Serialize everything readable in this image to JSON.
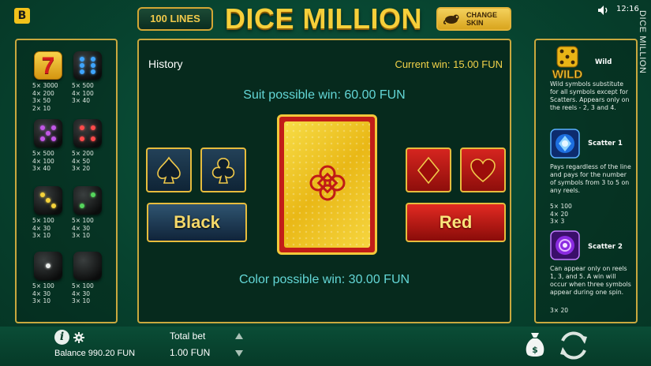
{
  "header": {
    "brand_letter": "B",
    "lines_label": "100 LINES",
    "game_title": "DICE MILLION",
    "change_skin_label": "CHANGE\nSKIN",
    "time": "12:16",
    "vertical_title": "DICE MILLION"
  },
  "paytable_left": [
    {
      "icon": "seven-die-icon",
      "pays": [
        "5× 3000",
        "4× 200",
        "3× 50",
        "2× 10"
      ]
    },
    {
      "icon": "blue-six-die-icon",
      "pays": [
        "5× 500",
        "4× 100",
        "3× 40"
      ]
    },
    {
      "icon": "purple-five-die-icon",
      "pays": [
        "5× 500",
        "4× 100",
        "3× 40"
      ]
    },
    {
      "icon": "red-four-die-icon",
      "pays": [
        "5× 200",
        "4× 50",
        "3× 20"
      ]
    },
    {
      "icon": "yellow-three-die-icon",
      "pays": [
        "5× 100",
        "4× 30",
        "3× 10"
      ]
    },
    {
      "icon": "green-two-die-icon",
      "pays": [
        "5× 100",
        "4× 30",
        "3× 10"
      ]
    },
    {
      "icon": "white-one-die-icon",
      "pays": [
        "5× 100",
        "4× 30",
        "3× 10"
      ]
    },
    {
      "icon": "blank-die-icon",
      "pays": [
        "5× 100",
        "4× 30",
        "3× 10"
      ]
    }
  ],
  "gamble": {
    "history_label": "History",
    "current_win": "Current win: 15.00 FUN",
    "suit_possible_win": "Suit possible win: 60.00 FUN",
    "color_possible_win": "Color possible win: 30.00 FUN",
    "black_label": "Black",
    "red_label": "Red",
    "suits": [
      "spade-icon",
      "club-icon",
      "diamond-icon",
      "heart-icon"
    ]
  },
  "paytable_right": {
    "wild": {
      "name": "Wild",
      "badge": "WILD",
      "text": "Wild symbols substitute for all symbols except for Scatters. Appears only on the reels - 2, 3 and 4."
    },
    "scatter1": {
      "name": "Scatter 1",
      "text": "Pays regardless of the line and pays for the number of symbols from 3 to 5 on any reels.",
      "pays": "5× 100\n4× 20\n3× 3"
    },
    "scatter2": {
      "name": "Scatter 2",
      "text": "Can appear only on reels 1, 3, and 5. A win will occur when three symbols appear during one spin.",
      "pays": "3× 20"
    }
  },
  "footer": {
    "balance": "Balance 990.20 FUN",
    "total_bet_label": "Total bet",
    "total_bet_value": "1.00 FUN"
  },
  "colors": {
    "background": "#07432f",
    "panel_border": "#c9a83e",
    "gold_text": "#f6cf3a",
    "cyan_text": "#63d6d6",
    "red_button": "#d5251f",
    "dark_button": "#234158"
  }
}
